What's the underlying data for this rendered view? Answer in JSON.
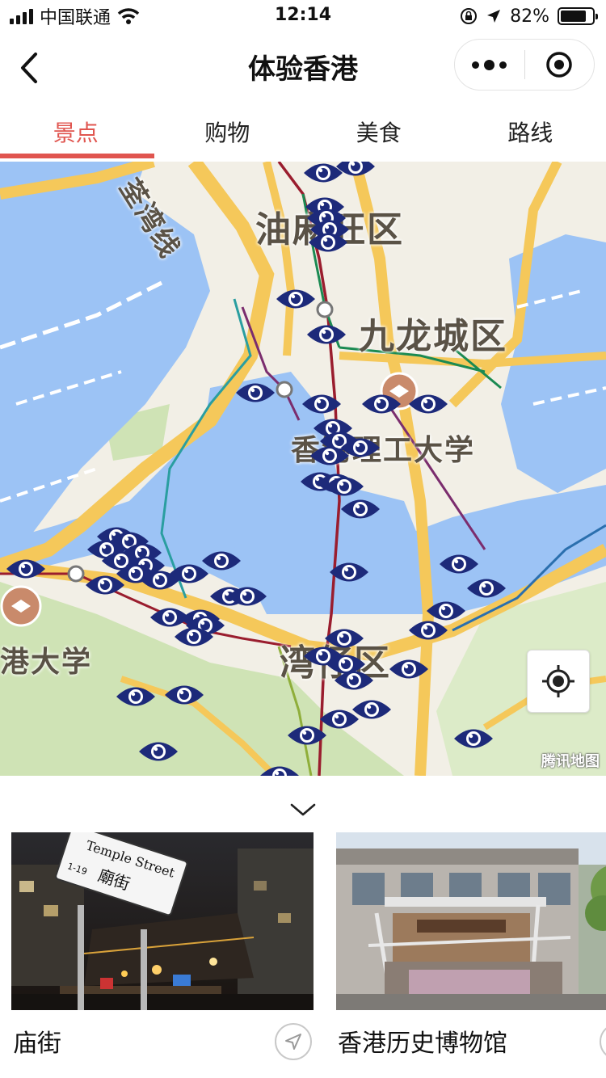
{
  "status_bar": {
    "carrier": "中国联通",
    "time": "12:14",
    "battery": "82%",
    "battery_level": 0.82
  },
  "nav": {
    "title": "体验香港",
    "back_icon": "chevron-left-icon",
    "more_icon": "more-dots-icon",
    "close_icon": "target-close-icon"
  },
  "tabs": [
    {
      "label": "景点",
      "active": true
    },
    {
      "label": "购物",
      "active": false
    },
    {
      "label": "美食",
      "active": false
    },
    {
      "label": "路线",
      "active": false
    }
  ],
  "map": {
    "labels": {
      "district_1": "油麻旺区",
      "district_2": "九龙城区",
      "university_1": "香港理工大学",
      "district_3": "湾仔区",
      "university_2": "港大学",
      "rail_line": "荃湾线"
    },
    "credit": "腾讯地图",
    "marker_icon": "eye-marker-icon",
    "locate_icon": "crosshair-icon",
    "colors": {
      "water": "#9cc3f5",
      "road": "#f5c85a",
      "marker": "#1d2a7a",
      "green": "#cfe3b5"
    }
  },
  "collapse_icon": "chevron-down-icon",
  "cards": [
    {
      "title": "庙街",
      "nav_icon": "navigate-arrow-icon",
      "sign_en": "Temple Street",
      "sign_cn": "廟街",
      "sign_no": "1-19"
    },
    {
      "title": "香港历史博物馆",
      "nav_icon": "navigate-arrow-icon"
    }
  ],
  "accent_color": "#e0554f"
}
